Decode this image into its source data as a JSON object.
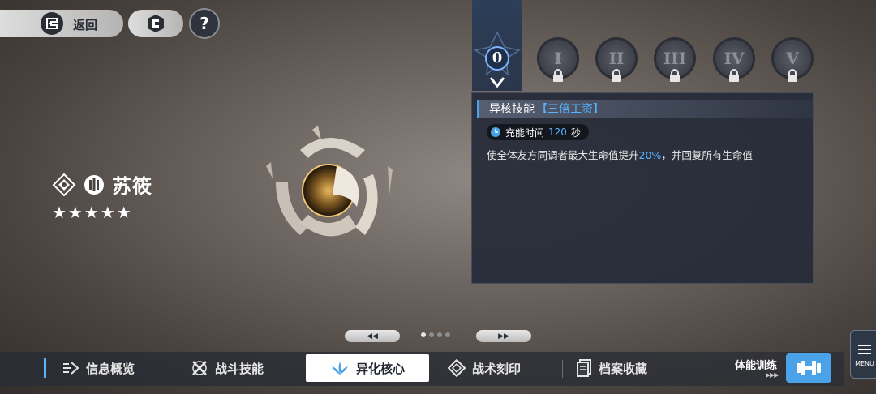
{
  "top_bar": {
    "back_label": "返回",
    "help_label": "?"
  },
  "character": {
    "name": "苏筱",
    "stars": "★★★★★",
    "star_count": 5
  },
  "tiers": {
    "active": "0",
    "locked": [
      "I",
      "II",
      "III",
      "IV",
      "V"
    ]
  },
  "skill": {
    "title": "异核技能",
    "name": "【三倍工资】",
    "charge_label": "充能时间",
    "charge_value": "120",
    "charge_unit": "秒",
    "desc_before": "使全体友方同调者最大生命值提升",
    "desc_highlight": "20%",
    "desc_after": "，并回复所有生命值"
  },
  "pager": {
    "prev": "◀◀",
    "next": "▶▶",
    "page_count": 4,
    "current_page": 1
  },
  "nav": {
    "tabs": [
      {
        "label": "信息概览",
        "icon": "overview-icon"
      },
      {
        "label": "战斗技能",
        "icon": "combat-skill-icon"
      },
      {
        "label": "异化核心",
        "icon": "core-icon"
      },
      {
        "label": "战术刻印",
        "icon": "tactical-imprint-icon"
      },
      {
        "label": "档案收藏",
        "icon": "archive-icon"
      }
    ],
    "active_tab": "异化核心",
    "training_label": "体能训练",
    "training_arrows": "▶▶▶",
    "menu_label": "MENU"
  },
  "colors": {
    "accent": "#4aa3e8",
    "highlight": "#58b4ff",
    "panel": "#262c38"
  }
}
